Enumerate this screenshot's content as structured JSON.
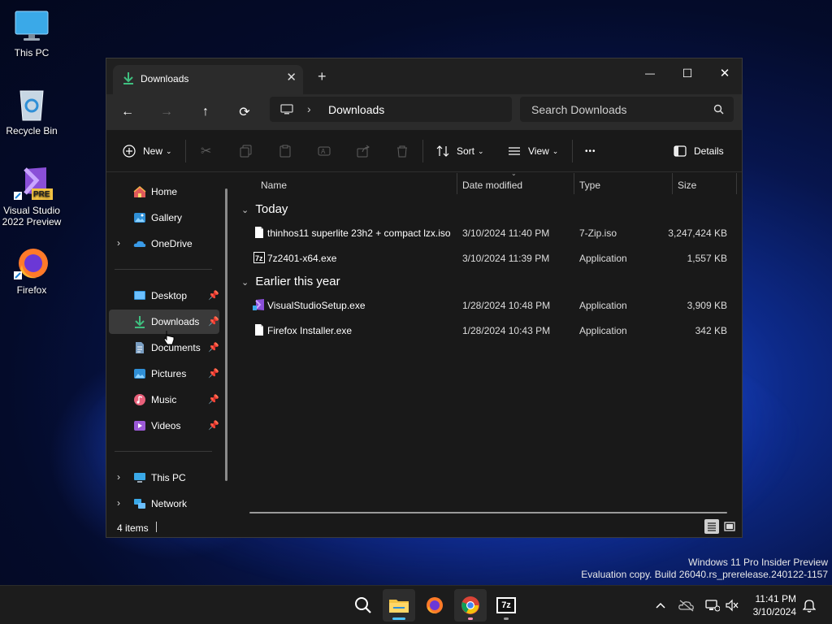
{
  "desktop": {
    "icons": [
      {
        "label": "This PC"
      },
      {
        "label": "Recycle Bin"
      },
      {
        "label": "Visual Studio 2022 Preview",
        "badge": "PRE"
      },
      {
        "label": "Firefox"
      }
    ],
    "watermark": {
      "line1": "Windows 11 Pro Insider Preview",
      "line2": "Evaluation copy. Build 26040.rs_prerelease.240122-1157"
    }
  },
  "window": {
    "tab_title": "Downloads",
    "tab_close": "✕",
    "new_tab": "+",
    "controls": {
      "minimize": "—",
      "maximize": "☐",
      "close": "✕"
    },
    "nav": {
      "back": "←",
      "forward": "→",
      "up": "↑",
      "refresh": "⟳"
    },
    "address": {
      "separator": "›",
      "current": "Downloads"
    },
    "search": {
      "placeholder": "Search Downloads"
    },
    "commands": {
      "new": "New",
      "sort": "Sort",
      "view": "View",
      "more": "•••",
      "details": "Details"
    },
    "nav_pane": {
      "items": [
        {
          "label": "Home"
        },
        {
          "label": "Gallery"
        },
        {
          "label": "OneDrive"
        },
        {
          "label": "Desktop"
        },
        {
          "label": "Downloads"
        },
        {
          "label": "Documents"
        },
        {
          "label": "Pictures"
        },
        {
          "label": "Music"
        },
        {
          "label": "Videos"
        },
        {
          "label": "This PC"
        },
        {
          "label": "Network"
        }
      ]
    },
    "columns": {
      "name": "Name",
      "date": "Date modified",
      "type": "Type",
      "size": "Size"
    },
    "groups": [
      {
        "title": "Today",
        "files": [
          {
            "name": "thinhos11 superlite 23h2 + compact lzx.iso",
            "date": "3/10/2024 11:40 PM",
            "type": "7-Zip.iso",
            "size": "3,247,424 KB"
          },
          {
            "name": "7z2401-x64.exe",
            "date": "3/10/2024 11:39 PM",
            "type": "Application",
            "size": "1,557 KB"
          }
        ]
      },
      {
        "title": "Earlier this year",
        "files": [
          {
            "name": "VisualStudioSetup.exe",
            "date": "1/28/2024 10:48 PM",
            "type": "Application",
            "size": "3,909 KB"
          },
          {
            "name": "Firefox Installer.exe",
            "date": "1/28/2024 10:43 PM",
            "type": "Application",
            "size": "342 KB"
          }
        ]
      }
    ],
    "status": {
      "items": "4 items"
    }
  },
  "taskbar": {
    "clock": {
      "time": "11:41 PM",
      "date": "3/10/2024"
    },
    "apps": [
      "search",
      "file-explorer",
      "firefox",
      "chrome",
      "7-zip"
    ],
    "seven_zip_label": "7z"
  },
  "colors": {
    "accent": "#4cc2ff",
    "folder": "#f3c343",
    "download": "#3fbf7f"
  }
}
